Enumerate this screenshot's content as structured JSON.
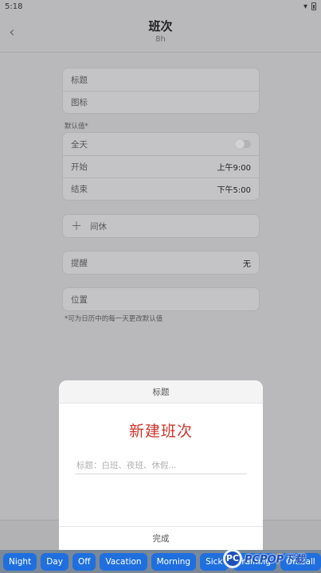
{
  "status": {
    "time": "5:18"
  },
  "header": {
    "title": "班次",
    "subtitle": "8h"
  },
  "form": {
    "title_label": "标题",
    "icon_label": "图标",
    "default_label": "默认值*",
    "all_day_label": "全天",
    "start_label": "开始",
    "start_value": "上午9:00",
    "end_label": "结束",
    "end_value": "下午5:00",
    "break_label": "间休",
    "reminder_label": "提醒",
    "reminder_value": "无",
    "location_label": "位置",
    "footnote": "*可为日历中的每一天更改默认值"
  },
  "dialog": {
    "header": "标题",
    "heading": "新建班次",
    "input_placeholder": "标题：白班、夜班、休假...",
    "done_label": "完成"
  },
  "chips": [
    "Night",
    "Day",
    "Off",
    "Vacation",
    "Morning",
    "Sick",
    "Training",
    "On-call"
  ],
  "watermark": {
    "circle": "PC",
    "text": "PCPOP下载"
  }
}
